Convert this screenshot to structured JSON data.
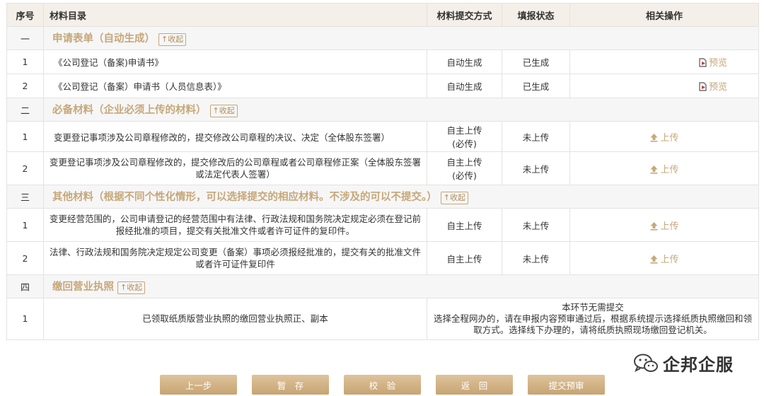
{
  "headers": {
    "no": "序号",
    "name": "材料目录",
    "method": "材料提交方式",
    "status": "填报状态",
    "action": "相关操作"
  },
  "collapse_label": "↑收起",
  "sections": [
    {
      "no": "一",
      "title": "申请表单（自动生成）",
      "items": [
        {
          "no": "1",
          "name": "《公司登记（备案)申请书》",
          "method": "自动生成",
          "status": "已生成",
          "action": "预览"
        },
        {
          "no": "2",
          "name": "《公司登记（备案）申请书（人员信息表）》",
          "method": "自动生成",
          "status": "已生成",
          "action": "预览"
        }
      ]
    },
    {
      "no": "二",
      "title": "必备材料（企业必须上传的材料）",
      "items": [
        {
          "no": "1",
          "name": "变更登记事项涉及公司章程修改的，提交修改公司章程的决议、决定（全体股东签署）",
          "method_line1": "自主上传",
          "method_line2": "(必传)",
          "status": "未上传",
          "action": "上传"
        },
        {
          "no": "2",
          "name": "变更登记事项涉及公司章程修改的，提交修改后的公司章程或者公司章程修正案（全体股东签署或法定代表人签署）",
          "method_line1": "自主上传",
          "method_line2": "(必传)",
          "status": "未上传",
          "action": "上传"
        }
      ]
    },
    {
      "no": "三",
      "title": "其他材料（根据不同个性化情形，可以选择提交的相应材料。不涉及的可以不提交。）",
      "items": [
        {
          "no": "1",
          "name": "变更经营范围的，公司申请登记的经营范围中有法律、行政法规和国务院决定规定必须在登记前报经批准的项目，提交有关批准文件或者许可证件的复印件。",
          "method": "自主上传",
          "status": "未上传",
          "action": "上传"
        },
        {
          "no": "2",
          "name": "法律、行政法规和国务院决定规定公司变更（备案）事项必须报经批准的，提交有关的批准文件或者许可证件复印件",
          "method": "自主上传",
          "status": "未上传",
          "action": "上传"
        }
      ]
    },
    {
      "no": "四",
      "title": "缴回营业执照",
      "items": [
        {
          "no": "1",
          "name": "已领取纸质版营业执照的缴回营业执照正、副本",
          "note_line1": "本环节无需提交",
          "note_line2": "选择全程网办的，请在申报内容预审通过后，根据系统提示选择纸质执照缴回和领取方式。选择线下办理的，请将纸质执照现场缴回登记机关。"
        }
      ]
    }
  ],
  "watermark": "企邦企服",
  "buttons": {
    "prev": "上一步",
    "save": "暂　存",
    "check": "校　验",
    "back": "返　回",
    "submit": "提交预审"
  },
  "colors": {
    "accent": "#c6a77a",
    "header_bg": "#f4efe8",
    "section_bg": "#f6f6f6",
    "button": "#d3b687"
  }
}
